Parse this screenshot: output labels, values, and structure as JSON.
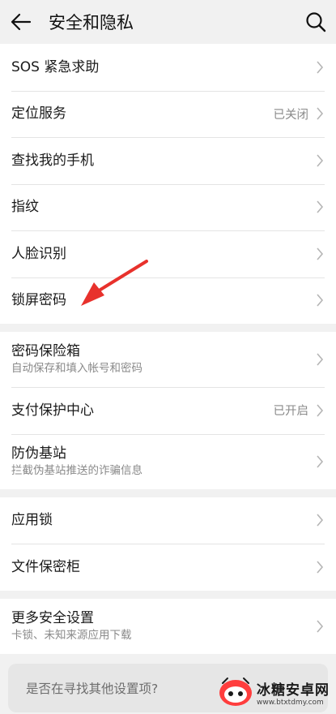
{
  "header": {
    "title": "安全和隐私",
    "back_icon": "arrow-left-icon",
    "search_icon": "search-icon"
  },
  "groups": [
    {
      "items": [
        {
          "label": "SOS 紧急求助",
          "value": "",
          "sub": ""
        },
        {
          "label": "定位服务",
          "value": "已关闭",
          "sub": ""
        },
        {
          "label": "查找我的手机",
          "value": "",
          "sub": ""
        },
        {
          "label": "指纹",
          "value": "",
          "sub": ""
        },
        {
          "label": "人脸识别",
          "value": "",
          "sub": ""
        },
        {
          "label": "锁屏密码",
          "value": "",
          "sub": ""
        }
      ]
    },
    {
      "items": [
        {
          "label": "密码保险箱",
          "value": "",
          "sub": "自动保存和填入帐号和密码"
        },
        {
          "label": "支付保护中心",
          "value": "已开启",
          "sub": ""
        },
        {
          "label": "防伪基站",
          "value": "",
          "sub": "拦截伪基站推送的诈骗信息"
        }
      ]
    },
    {
      "items": [
        {
          "label": "应用锁",
          "value": "",
          "sub": ""
        },
        {
          "label": "文件保密柜",
          "value": "",
          "sub": ""
        }
      ]
    },
    {
      "items": [
        {
          "label": "更多安全设置",
          "value": "",
          "sub": "卡锁、未知来源应用下载"
        }
      ]
    }
  ],
  "search_prompt": "是否在寻找其他设置项?",
  "watermark": {
    "name": "冰糖安卓网",
    "url": "www.btxtdmy.com"
  },
  "colors": {
    "background": "#f1f1f1",
    "card": "#ffffff",
    "annotation_arrow": "#e8312c"
  }
}
